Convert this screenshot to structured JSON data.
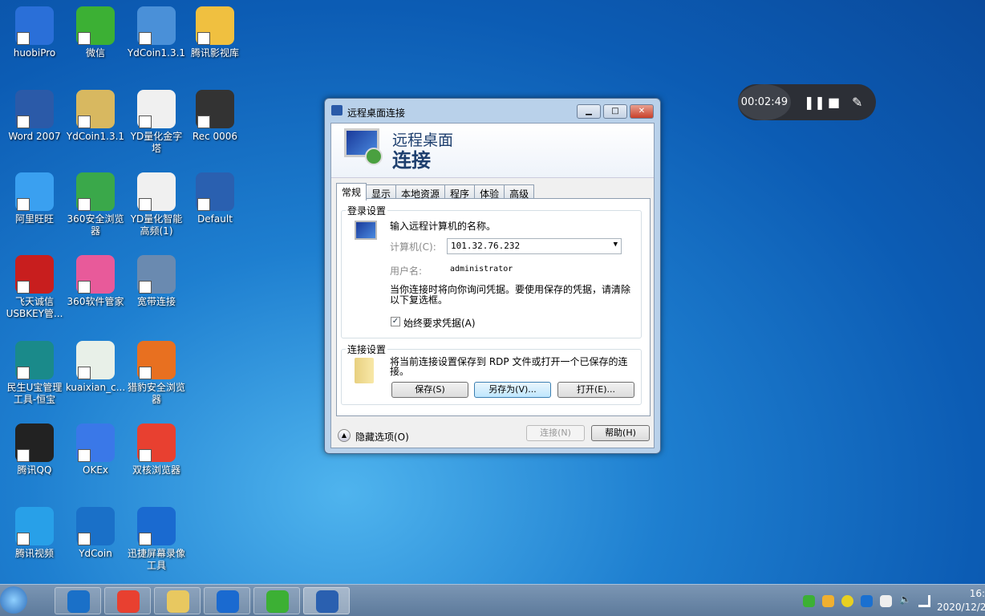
{
  "desktop_icons": [
    {
      "label": "huobiPro",
      "color": "#2a6fd8"
    },
    {
      "label": "Word 2007",
      "color": "#2b5aa8"
    },
    {
      "label": "阿里旺旺",
      "color": "#3aa0f0"
    },
    {
      "label": "飞天诚信USBKEY管...",
      "color": "#c81e1e"
    },
    {
      "label": "民生U宝管理工具-恒宝",
      "color": "#1a8a8a"
    },
    {
      "label": "腾讯QQ",
      "color": "#222222"
    },
    {
      "label": "腾讯视频",
      "color": "#28a0e8"
    },
    {
      "label": "微信",
      "color": "#3cb034"
    },
    {
      "label": "YdCoin1.3.1",
      "color": "#d8b860"
    },
    {
      "label": "360安全浏览器",
      "color": "#3aa84a"
    },
    {
      "label": "360软件管家",
      "color": "#e85a9a"
    },
    {
      "label": "kuaixian_c...",
      "color": "#e8f0e8"
    },
    {
      "label": "OKEx",
      "color": "#3a78e8"
    },
    {
      "label": "YdCoin",
      "color": "#1a70c8"
    },
    {
      "label": "YdCoin1.3.1",
      "color": "#4a90d8"
    },
    {
      "label": "YD量化金字塔",
      "color": "#f0f0f0"
    },
    {
      "label": "YD量化智能高频(1)",
      "color": "#f0f0f0"
    },
    {
      "label": "宽带连接",
      "color": "#6a8ab0"
    },
    {
      "label": "猎豹安全浏览器",
      "color": "#e87020"
    },
    {
      "label": "双核浏览器",
      "color": "#e84030"
    },
    {
      "label": "迅捷屏幕录像工具",
      "color": "#1a6ad0"
    },
    {
      "label": "腾讯影视库",
      "color": "#f0c040"
    },
    {
      "label": "Rec 0006",
      "color": "#333333"
    },
    {
      "label": "Default",
      "color": "#2a60b0"
    }
  ],
  "recorder": {
    "time": "00:02:49",
    "pause_icon": "pause-icon",
    "stop_icon": "stop-icon",
    "pen_icon": "pen-icon"
  },
  "dialog": {
    "title": "远程桌面连接",
    "header_line1": "远程桌面",
    "header_line2": "连接",
    "tabs": [
      "常规",
      "显示",
      "本地资源",
      "程序",
      "体验",
      "高级"
    ],
    "login_group": "登录设置",
    "enter_name": "输入远程计算机的名称。",
    "computer_label": "计算机(C):",
    "computer_value": "101.32.76.232",
    "username_label": "用户名:",
    "username_value": "administrator",
    "credentials_note": "当你连接时将向你询问凭据。要使用保存的凭据，请清除以下复选框。",
    "always_ask": "始终要求凭据(A)",
    "always_ask_checked": true,
    "conn_group": "连接设置",
    "conn_note": "将当前连接设置保存到 RDP 文件或打开一个已保存的连接。",
    "save": "保存(S)",
    "save_as": "另存为(V)...",
    "open": "打开(E)...",
    "hide_options": "隐藏选项(O)",
    "connect": "连接(N)",
    "help": "帮助(H)"
  },
  "taskbar": {
    "items": [
      {
        "name": "ydcoin",
        "color": "#1a70c8"
      },
      {
        "name": "chrome",
        "color": "#e84030"
      },
      {
        "name": "explorer",
        "color": "#e8c860"
      },
      {
        "name": "screen-recorder",
        "color": "#1a6ad0"
      },
      {
        "name": "wechat",
        "color": "#3cb034"
      },
      {
        "name": "remote-desktop",
        "color": "#2a60b0"
      }
    ],
    "clock_time": "16:",
    "clock_date": "2020/12/2"
  }
}
